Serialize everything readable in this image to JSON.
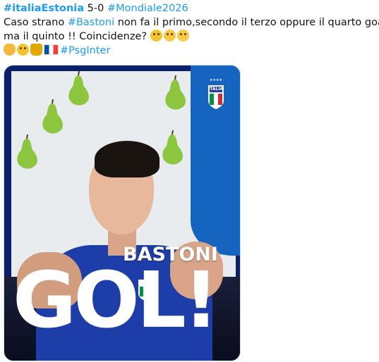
{
  "tweet": {
    "line1": {
      "hashtag_italia_estonia": "#italiaEstonia",
      "score": " 5-0 ",
      "hashtag_mondiale": "#Mondiale2026"
    },
    "line2": {
      "text_a": "Caso strano ",
      "hashtag_bastoni": "#Bastoni",
      "text_b": " non fa il primo,secondo il terzo oppure il quarto goal"
    },
    "line3": {
      "text": "ma il quinto !! Coincidenze? "
    },
    "line4": {
      "hashtag_psginter": "#PsgInter"
    },
    "emojis_line3": [
      "thinking-face",
      "laughing-face",
      "grinning-face"
    ],
    "emojis_line4": [
      "clapping-hands",
      "relieved-face",
      "trophy",
      "flag-france"
    ]
  },
  "media": {
    "player_name": "BASTONI",
    "goal_text": "GOL!",
    "crest_text": "ITALIA",
    "colors": {
      "blue_panel": "#1565c0",
      "jersey": "#1d3ea8",
      "pear": "#8cc63f",
      "hashtag": "#1d9bf0"
    }
  }
}
